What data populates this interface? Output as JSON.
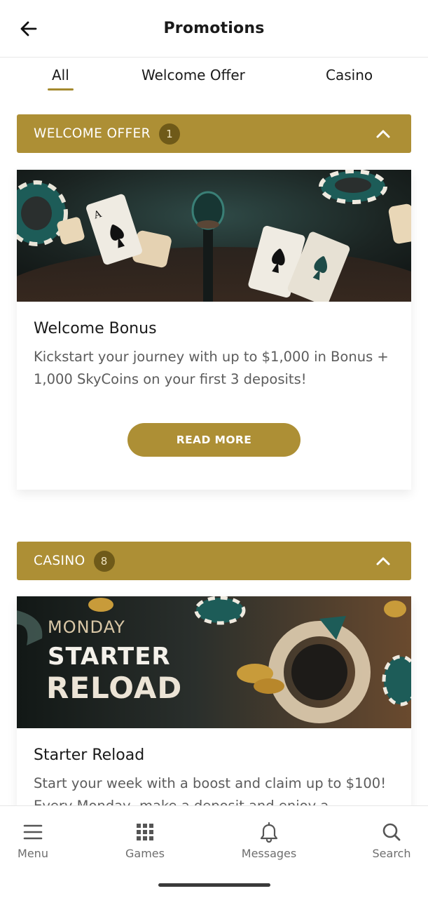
{
  "header": {
    "title": "Promotions"
  },
  "tabs": [
    {
      "label": "All",
      "active": true
    },
    {
      "label": "Welcome Offer",
      "active": false
    },
    {
      "label": "Casino",
      "active": false
    }
  ],
  "sections": [
    {
      "title": "WELCOME OFFER",
      "count": "1",
      "card": {
        "title": "Welcome Bonus",
        "description": "Kickstart your journey with up to $1,000 in Bonus + 1,000 SkyCoins on your first 3 deposits!",
        "button_label": "READ MORE"
      }
    },
    {
      "title": "CASINO",
      "count": "8",
      "card": {
        "banner_line1": "MONDAY",
        "banner_line2": "STARTER",
        "banner_line3": "RELOAD",
        "title": "Starter Reload",
        "description": "Start your week with a boost and claim up to $100! Every Monday, make a deposit and enjoy a"
      }
    }
  ],
  "bottom_nav": [
    {
      "label": "Menu",
      "icon": "menu-icon"
    },
    {
      "label": "Games",
      "icon": "grid-icon"
    },
    {
      "label": "Messages",
      "icon": "bell-icon"
    },
    {
      "label": "Search",
      "icon": "search-icon"
    }
  ],
  "colors": {
    "accent": "#ad8f35",
    "badge": "#6f5a19"
  }
}
